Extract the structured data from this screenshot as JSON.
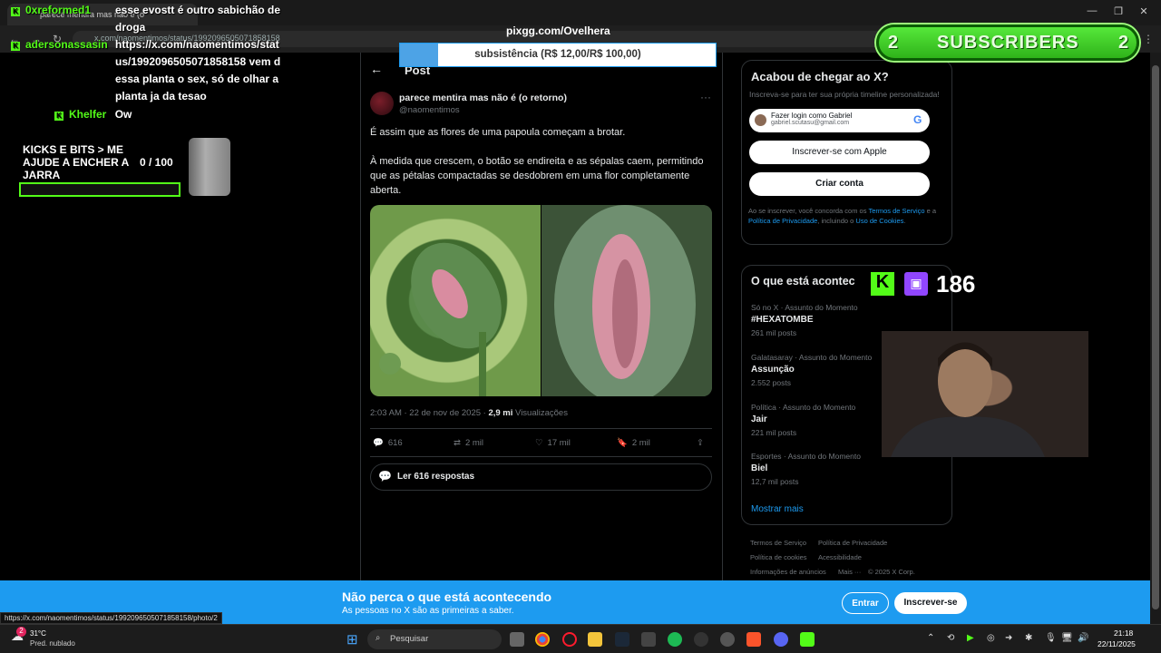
{
  "browser": {
    "tab_title": "parece mentira mas não é (o",
    "address": "x.com/naomentimos/status/1992096505071858158"
  },
  "post": {
    "header": "Post",
    "author": "parece mentira mas não é (o retorno)",
    "handle": "@naomentimos",
    "text1": "É assim que as flores de uma papoula começam a brotar.",
    "text2": "À medida que crescem, o botão se endireita e as sépalas caem, permitindo que as pétalas compactadas se desdobrem em uma flor completamente aberta.",
    "timestamp": "2:03 AM · 22 de nov de 2025 ·",
    "views_count": "2,9 mi",
    "views_label": "Visualizações",
    "replies": "616",
    "reposts": "2 mil",
    "likes": "17 mil",
    "bookmarks": "2 mil",
    "read_replies": "Ler 616 respostas"
  },
  "signup": {
    "title": "Acabou de chegar ao X?",
    "subtitle": "Inscreva-se para ter sua própria timeline personalizada!",
    "google_line1": "Fazer login como Gabriel",
    "google_line2": "gabriel.scutasu@gmail.com",
    "apple": "Inscrever-se com Apple",
    "create": "Criar conta",
    "legal_1": "Ao se inscrever, você concorda com os ",
    "terms": "Termos de Serviço",
    "legal_2": " e a ",
    "privacy": "Política de Privacidade",
    "legal_3": ", incluindo o ",
    "cookies": "Uso de Cookies",
    "legal_4": "."
  },
  "trends": {
    "title": "O que está acontec",
    "items": [
      {
        "category": "Só no X · Assunto do Momento",
        "name": "#HEXATOMBE",
        "posts": "261 mil posts"
      },
      {
        "category": "Galatasaray · Assunto do Momento",
        "name": "Assunção",
        "posts": "2.552 posts"
      },
      {
        "category": "Política · Assunto do Momento",
        "name": "Jair",
        "posts": "221 mil posts"
      },
      {
        "category": "Esportes · Assunto do Momento",
        "name": "Biel",
        "posts": "12,7 mil posts"
      }
    ],
    "show_more": "Mostrar mais"
  },
  "footer": {
    "l1": "Termos de Serviço",
    "l2": "Política de Privacidade",
    "l3": "Política de cookies",
    "l4": "Acessibilidade",
    "l5": "Informações de anúncios",
    "l6": "Mais ···",
    "l7": "© 2025 X Corp."
  },
  "banner": {
    "title": "Não perca o que está acontecendo",
    "subtitle": "As pessoas no X são as primeiras a saber.",
    "login": "Entrar",
    "signup": "Inscrever-se"
  },
  "status_url": "https://x.com/naomentimos/status/1992096505071858158/photo/2",
  "taskbar": {
    "weather_temp": "31°C",
    "weather_desc": "Pred. nublado",
    "weather_badge": "2",
    "search": "Pesquisar",
    "time": "21:18",
    "date": "22/11/2025"
  },
  "overlay": {
    "chat": [
      {
        "user": "0xreformed1",
        "message": "esse evostt é outro sabichão de droga"
      },
      {
        "user": "adersonassasin",
        "message": "https://x.com/naomentimos/status/1992096505071858158 vem dessa planta o sex, só de olhar a planta ja da tesao"
      },
      {
        "user": "Khelfer",
        "message": "Ow"
      }
    ],
    "kick_goal": "KICKS E BITS > ME AJUDE A ENCHER A JARRA",
    "kick_progress": "0   / 100",
    "pix_url": "pixgg.com/Ovelhera",
    "pix_goal": "subsistência (R$ 12,00/R$ 100,00)",
    "pix_fraction": 0.12,
    "subs_left": "2",
    "subs_label": "SUBSCRIBERS",
    "subs_right": "2",
    "viewers": "186"
  }
}
